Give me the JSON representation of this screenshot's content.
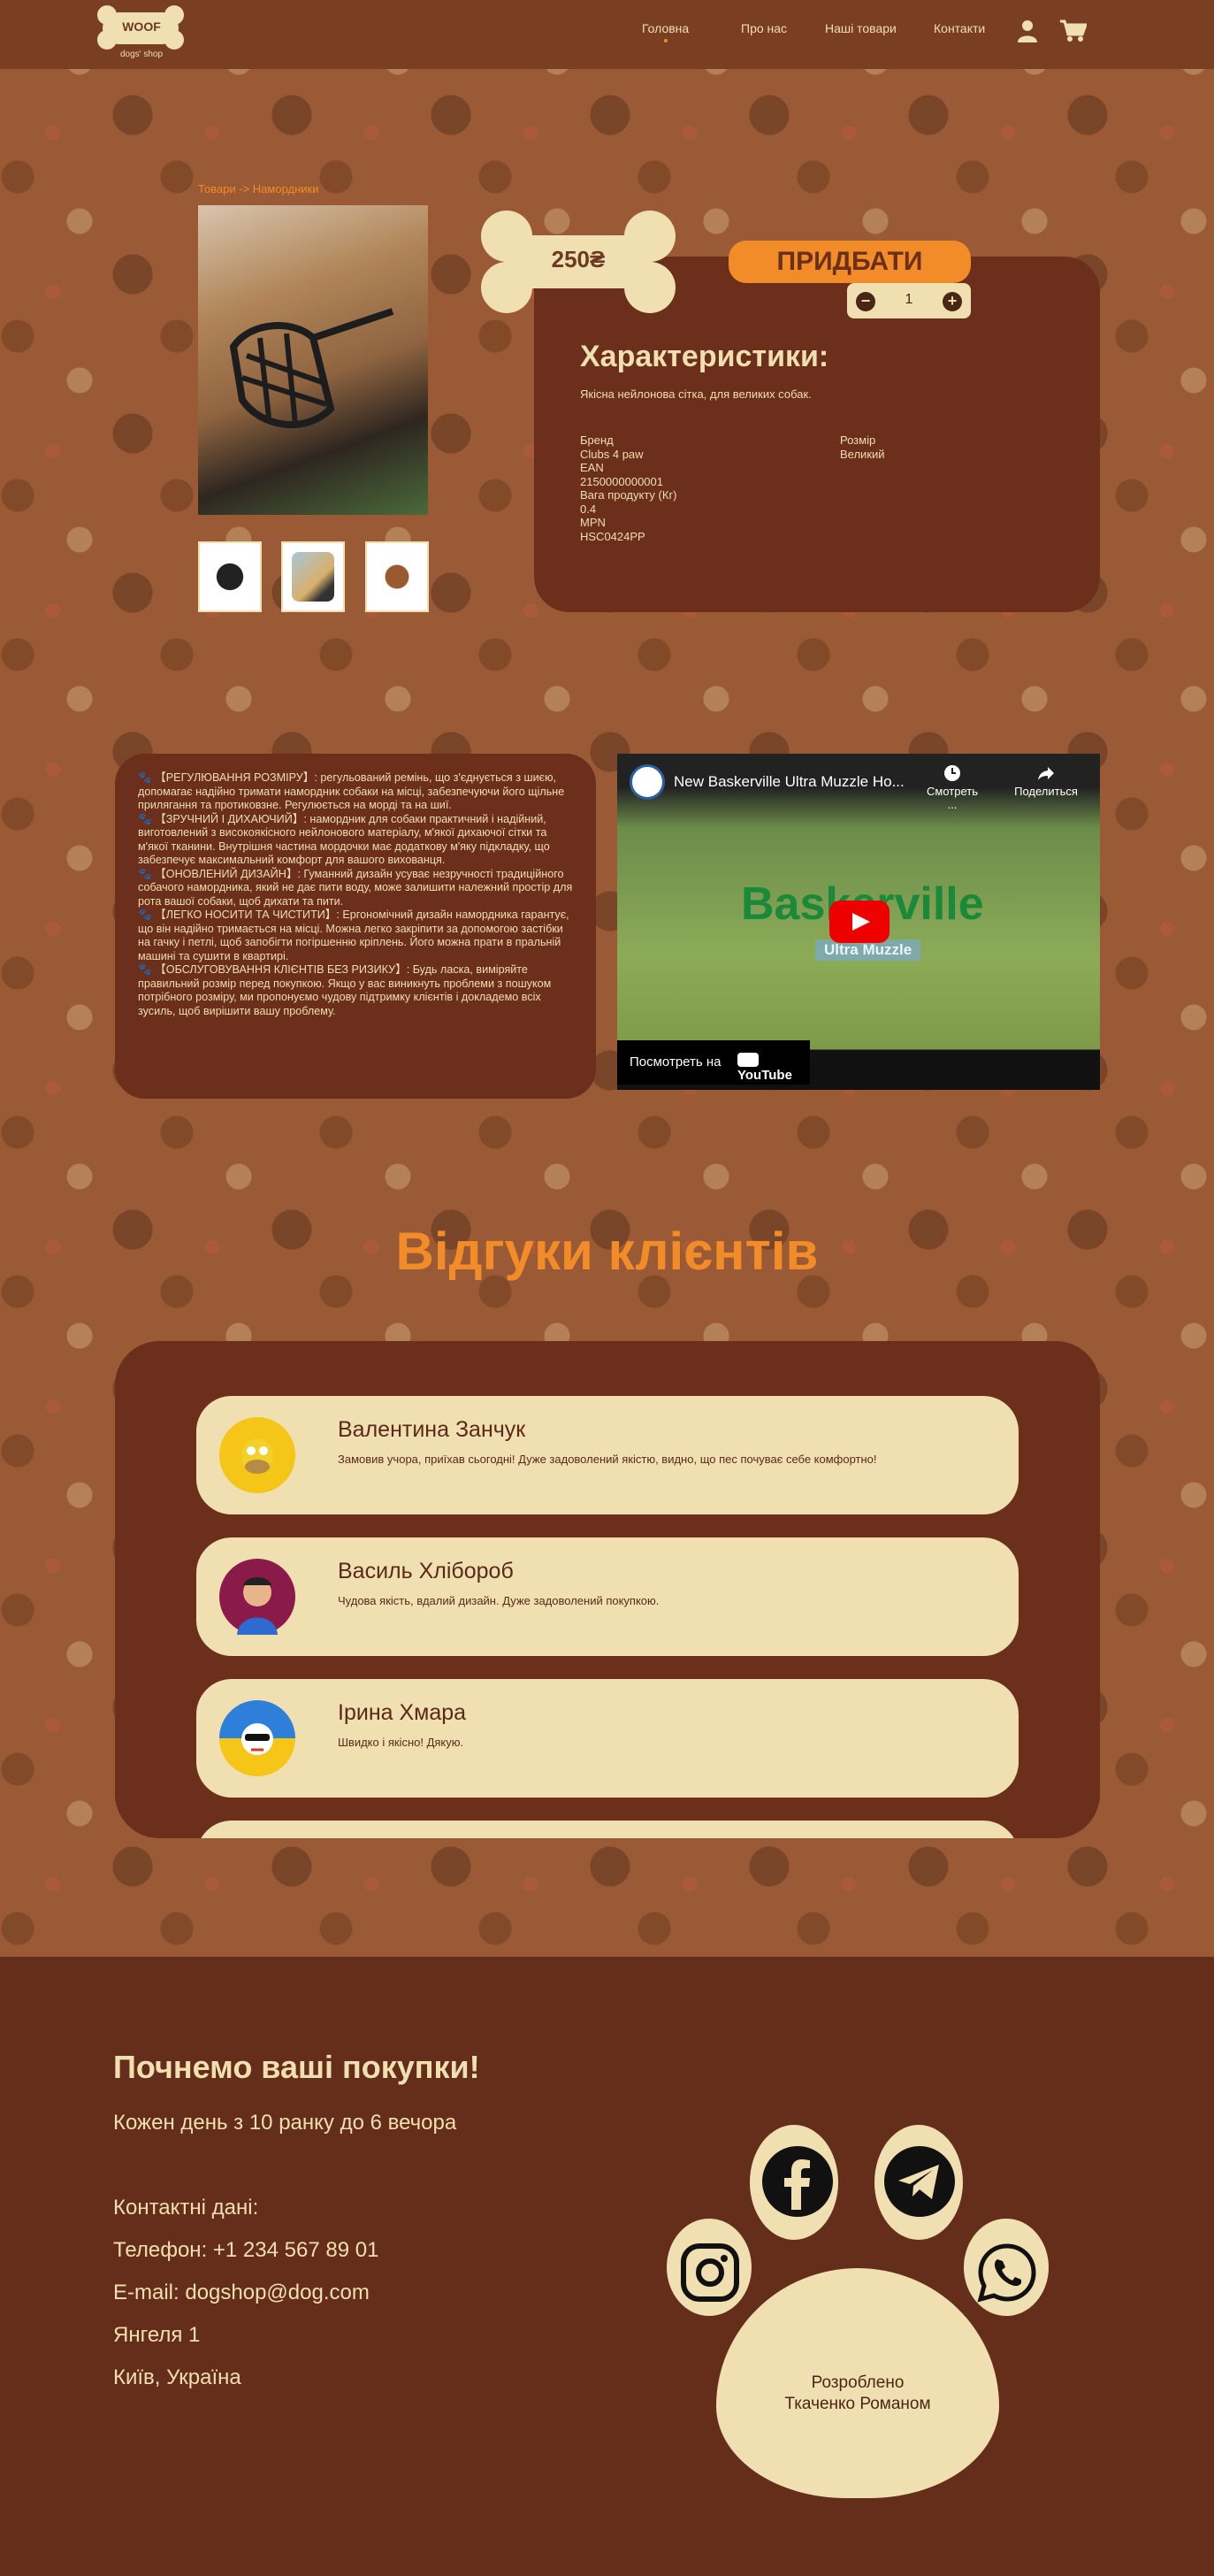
{
  "header": {
    "logo_word": "WOOF",
    "logo_sub": "dogs' shop",
    "nav": [
      "Головна",
      "Про нас",
      "Наші товари",
      "Контакти"
    ]
  },
  "product": {
    "breadcrumb": "Товари -> Намордники",
    "price": "250₴",
    "buy_label": "ПРИДБАТИ",
    "quantity": "1",
    "qty_minus": "−",
    "qty_plus": "+",
    "char_title": "Характеристики:",
    "char_desc": "Якісна нейлонова сітка, для великих собак.",
    "specs": [
      "Бренд",
      "Clubs 4 paw",
      "EAN",
      "2150000000001",
      "Вага продукту (Кг)",
      "0.4",
      "MPN",
      "HSC0424PP"
    ],
    "specs_right": [
      "Розмір",
      "Великий"
    ]
  },
  "description": [
    "🐾 【РЕГУЛЮВАННЯ РОЗМІРУ】: регульований ремінь, що з'єднується з шиєю, допомагає надійно тримати намордник собаки на місці, забезпечуючи його щільне прилягання та протиковзне. Регулюється на морді та на шиї.",
    "🐾 【ЗРУЧНИЙ І ДИХАЮЧИЙ】: намордник для собаки практичний і надійний, виготовлений з високоякісного нейлонового матеріалу, м'якої дихаючої сітки та м'якої тканини. Внутрішня частина мордочки має додаткову м'яку підкладку, що забезпечує максимальний комфорт для вашого вихованця.",
    "🐾 【ОНОВЛЕНИЙ ДИЗАЙН】: Гуманний дизайн усуває незручності традиційного собачого намордника, який не дає пити воду, може залишити належний простір для рота вашої собаки, щоб дихати та пити.",
    "🐾 【ЛЕГКО НОСИТИ ТА ЧИСТИТИ】: Ергономічний дизайн намордника гарантує, що він надійно тримається на місці. Можна легко закріпити за допомогою застібки на гачку і петлі, щоб запобігти погіршенню кріплень. Його можна прати в пральній машині та сушити в квартирі.",
    "🐾 【ОБСЛУГОВУВАННЯ КЛІЄНТІВ БЕЗ РИЗИКУ】: Будь ласка, виміряйте правильний розмір перед покупкою. Якщо у вас виникнуть проблеми з пошуком потрібного розміру, ми пропонуємо чудову підтримку клієнтів і докладемо всіх зусиль, щоб вирішити вашу проблему."
  ],
  "video": {
    "title": "New Baskerville Ultra Muzzle Ho...",
    "watch_later": "Смотреть ...",
    "share": "Поделиться",
    "brand": "Baskerville",
    "brand_sub": "Ultra Muzzle",
    "watch_on": "Посмотреть на",
    "yt": "YouTube"
  },
  "reviews": {
    "title": "Відгуки клієнтів",
    "items": [
      {
        "name": "Валентина Занчук",
        "text": "Замовив учора, приїхав сьогодні! Дуже задоволений якістю, видно, що пес почуває себе комфортно!",
        "avatar_color": "#f5c518"
      },
      {
        "name": "Василь Хлібороб",
        "text": "Чудова якість, вдалий дизайн. Дуже задоволений покупкою.",
        "avatar_color": "#8a1a4a"
      },
      {
        "name": "Ірина Хмара",
        "text": "Швидко і якісно! Дякую.",
        "avatar_color": "#2e7fd9"
      }
    ]
  },
  "footer": {
    "title": "Почнемо ваші покупки!",
    "hours": "Кожен день з 10 ранку до 6 вечора",
    "contacts_label": "Контактні дані:",
    "phone": "Телефон: +1 234 567 89 01",
    "email": "E-mail: dogshop@dog.com",
    "street": "Янгеля 1",
    "city": "Київ, Україна",
    "made_by": "Розроблено",
    "author": "Ткаченко Романом"
  },
  "colors": {
    "accent": "#f28c28",
    "cream": "#f0dfb0",
    "dark_brown": "#6b2f1b"
  }
}
